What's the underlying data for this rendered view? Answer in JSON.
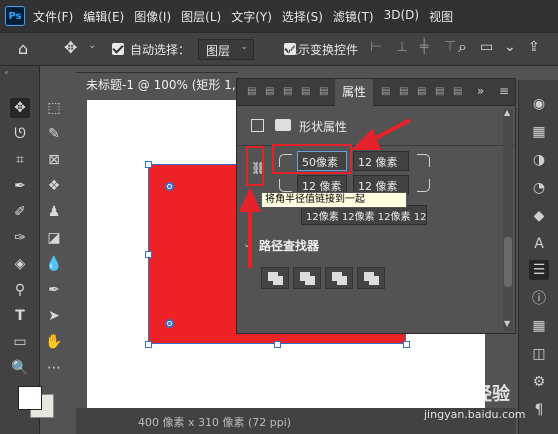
{
  "app": {
    "logo": "Ps"
  },
  "menubar": {
    "items": [
      "文件(F)",
      "编辑(E)",
      "图像(I)",
      "图层(L)",
      "文字(Y)",
      "选择(S)",
      "滤镜(T)",
      "3D(D)",
      "视图"
    ]
  },
  "options": {
    "auto_select_label": "自动选择：",
    "auto_select_value": "图层",
    "show_transform_label": "显示变换控件"
  },
  "document": {
    "tab_title": "未标题-1 @ 100% (矩形 1, R",
    "status": "400 像素 x 310 像素 (72 ppi)"
  },
  "properties": {
    "tab_label": "属性",
    "section_title": "形状属性",
    "corner_tl": "50",
    "corner_tr": "12 像素",
    "corner_bl": "12 像素",
    "corner_br": "12 像素",
    "unit": "像素",
    "link_tooltip": "将角半径值链接到一起",
    "row3_values": "12像素 12像素 12像素 12像",
    "pathfinder_title": "路径查找器"
  },
  "colors": {
    "shape_fill": "#ec2227",
    "annotation": "#e5222a",
    "selection": "#3a6ec9"
  },
  "watermark": {
    "text": "Baidu 经验",
    "url": "jingyan.baidu.com"
  }
}
